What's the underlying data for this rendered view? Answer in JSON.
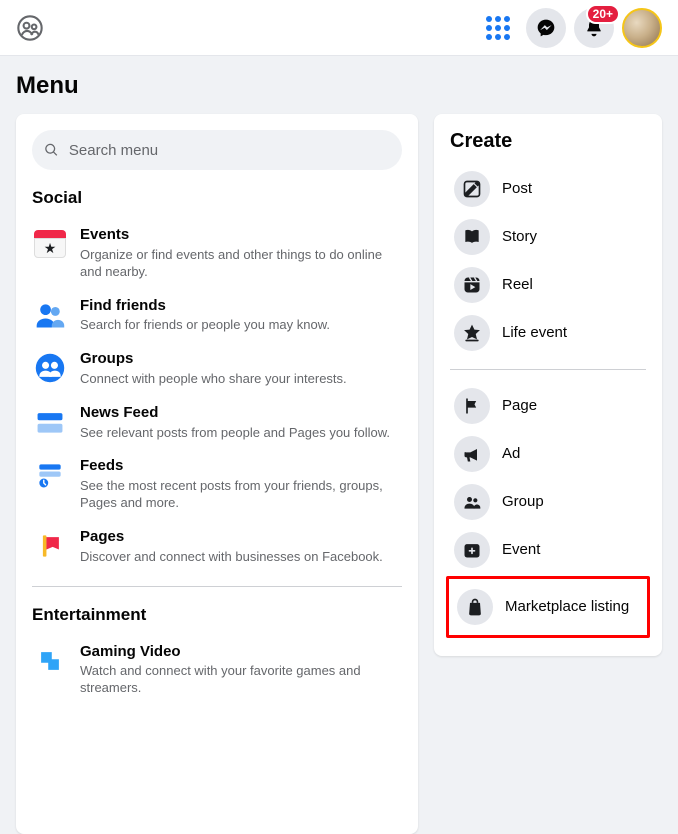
{
  "header": {
    "notification_badge": "20+"
  },
  "page_title": "Menu",
  "search": {
    "placeholder": "Search menu"
  },
  "sections": {
    "social": {
      "heading": "Social"
    },
    "entertainment": {
      "heading": "Entertainment"
    }
  },
  "menu": {
    "events": {
      "title": "Events",
      "desc": "Organize or find events and other things to do online and nearby."
    },
    "findfriends": {
      "title": "Find friends",
      "desc": "Search for friends or people you may know."
    },
    "groups": {
      "title": "Groups",
      "desc": "Connect with people who share your interests."
    },
    "newsfeed": {
      "title": "News Feed",
      "desc": "See relevant posts from people and Pages you follow."
    },
    "feeds": {
      "title": "Feeds",
      "desc": "See the most recent posts from your friends, groups, Pages and more."
    },
    "pages": {
      "title": "Pages",
      "desc": "Discover and connect with businesses on Facebook."
    },
    "gaming": {
      "title": "Gaming Video",
      "desc": "Watch and connect with your favorite games and streamers."
    }
  },
  "create": {
    "heading": "Create",
    "post": "Post",
    "story": "Story",
    "reel": "Reel",
    "lifeevent": "Life event",
    "page": "Page",
    "ad": "Ad",
    "group": "Group",
    "event": "Event",
    "marketplace": "Marketplace listing"
  }
}
